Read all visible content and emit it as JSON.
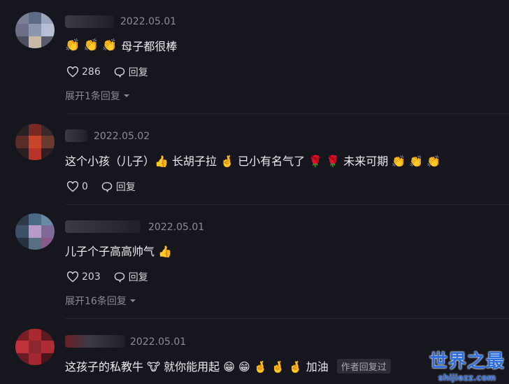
{
  "comments": [
    {
      "date": "2022.05.01",
      "emoji_prefix": "👏 👏 👏",
      "text": "母子都很棒",
      "likes": "286",
      "reply_label": "回复",
      "expand": "展开1条回复"
    },
    {
      "date": "2022.05.02",
      "text": "这个小孩（儿子）👍 长胡子拉 🤞 已小有名气了 🌹 🌹 未来可期 👏 👏 👏",
      "likes": "0",
      "reply_label": "回复"
    },
    {
      "date": "2022.05.01",
      "text": "儿子个子高高帅气 👍",
      "likes": "203",
      "reply_label": "回复",
      "expand": "展开16条回复"
    },
    {
      "date": "2022.05.01",
      "text": "这孩子的私教牛 🐮 就你能用起 😁 😁 🤞 🤞 🤞 加油",
      "author_tag": "作者回复过"
    }
  ],
  "watermark": {
    "title": "世界之最",
    "url": "shijiezz.com"
  },
  "colors": {
    "background": "#16161e",
    "watermark": "#2e6fe0"
  }
}
